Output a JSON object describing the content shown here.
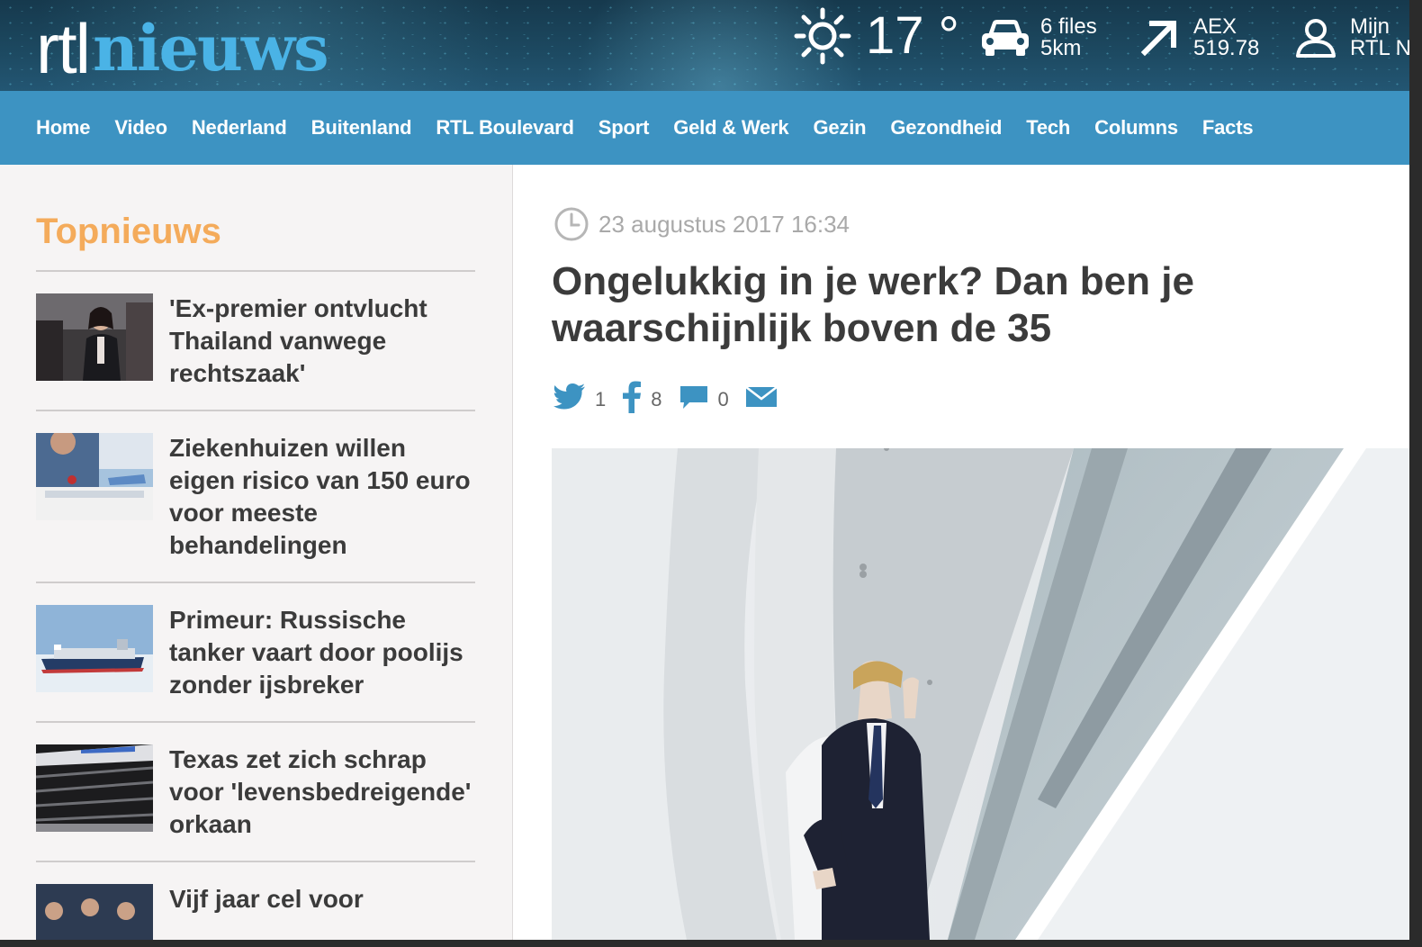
{
  "header": {
    "logo_rtl": "rtl",
    "logo_nieuws": "nieuws",
    "weather": {
      "temperature": "17 °",
      "icon": "sun-icon"
    },
    "traffic": {
      "line1": "6 files",
      "line2": "5km",
      "icon": "car-icon"
    },
    "aex": {
      "label": "AEX",
      "value": "519.78",
      "icon": "arrow-up-right-icon"
    },
    "account": {
      "line1": "Mijn",
      "line2": "RTL N",
      "icon": "user-icon"
    }
  },
  "nav": {
    "items": [
      "Home",
      "Video",
      "Nederland",
      "Buitenland",
      "RTL Boulevard",
      "Sport",
      "Geld & Werk",
      "Gezin",
      "Gezondheid",
      "Tech",
      "Columns",
      "Facts"
    ]
  },
  "sidebar": {
    "title": "Topnieuws",
    "items": [
      {
        "title": "'Ex-premier ontvlucht Thailand vanwege rechtszaak'"
      },
      {
        "title": "Ziekenhuizen willen eigen risico van 150 euro voor meeste behandelingen"
      },
      {
        "title": "Primeur: Russische tanker vaart door poolijs zonder ijsbreker"
      },
      {
        "title": "Texas zet zich schrap voor 'levensbedreigende' orkaan"
      },
      {
        "title": "Vijf jaar cel voor"
      }
    ]
  },
  "article": {
    "date": "23 augustus 2017 16:34",
    "headline": "Ongelukkig in je werk? Dan ben je waarschijnlijk boven de 35",
    "share": {
      "twitter_count": "1",
      "facebook_count": "8",
      "comments_count": "0"
    }
  },
  "colors": {
    "nav_bg": "#3d93c2",
    "brand_blue": "#4ab3e6",
    "topnieuws_orange": "#f4ab5b",
    "text_dark": "#3b3b3b"
  }
}
